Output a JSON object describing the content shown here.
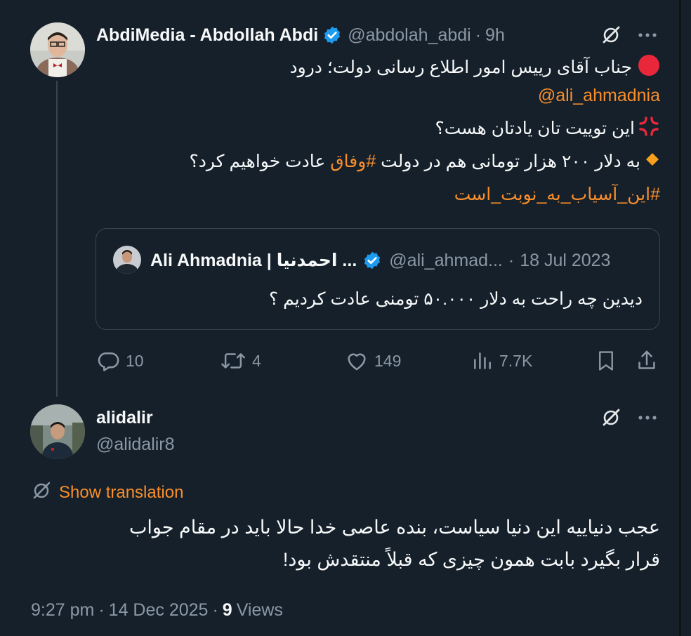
{
  "colors": {
    "background": "#15202b",
    "accent": "#f98e2a",
    "muted": "#8b98a5",
    "verified": "#1d9bf0",
    "red_dot": "#e8283a"
  },
  "post": {
    "author_name": "AbdiMedia - Abdollah Abdi",
    "author_handle": "@abdolah_abdi",
    "separator": "·",
    "time": "9h",
    "line1": "جناب آقای رییس امور اطلاع رسانی دولت؛ درود",
    "mention": "@ali_ahmadnia",
    "line3": "این توییت تان یادتان هست؟",
    "line4_before": "به دلار ۲۰۰ هزار تومانی هم در دولت ",
    "line4_hashtag": "#وفاق",
    "line4_after": " عادت خواهیم کرد؟",
    "hashtag_line": "#این_آسیاب_به_نوبت_است",
    "icons": [
      "red-circle-icon",
      "anger-symbol-icon",
      "orange-diamond-icon",
      "verified-badge-icon",
      "grok-slash-icon",
      "more-icon"
    ]
  },
  "quote": {
    "author_name": "Ali Ahmadnia | احمدنیا ...",
    "author_handle": "@ali_ahmad...",
    "separator": "·",
    "date": "18 Jul 2023",
    "text": "دیدین چه راحت به دلار ۵۰.۰۰۰ تومنی عادت کردیم ؟"
  },
  "actions": {
    "replies": "10",
    "reposts": "4",
    "likes": "149",
    "views": "7.7K"
  },
  "reply": {
    "author_name": "alidalir",
    "author_handle": "@alidalir8",
    "show_translation": "Show translation",
    "line1": "عجب دنیاییه این دنیا سیاست، بنده عاصی خدا حالا باید در مقام جواب",
    "line2": "قرار بگیرد بابت همون چیزی که قبلاً منتقدش بود!",
    "meta_time": "9:27 pm",
    "meta_sep1": "·",
    "meta_date": "14 Dec 2025",
    "meta_sep2": "·",
    "views_count": "9",
    "views_label": "Views"
  }
}
